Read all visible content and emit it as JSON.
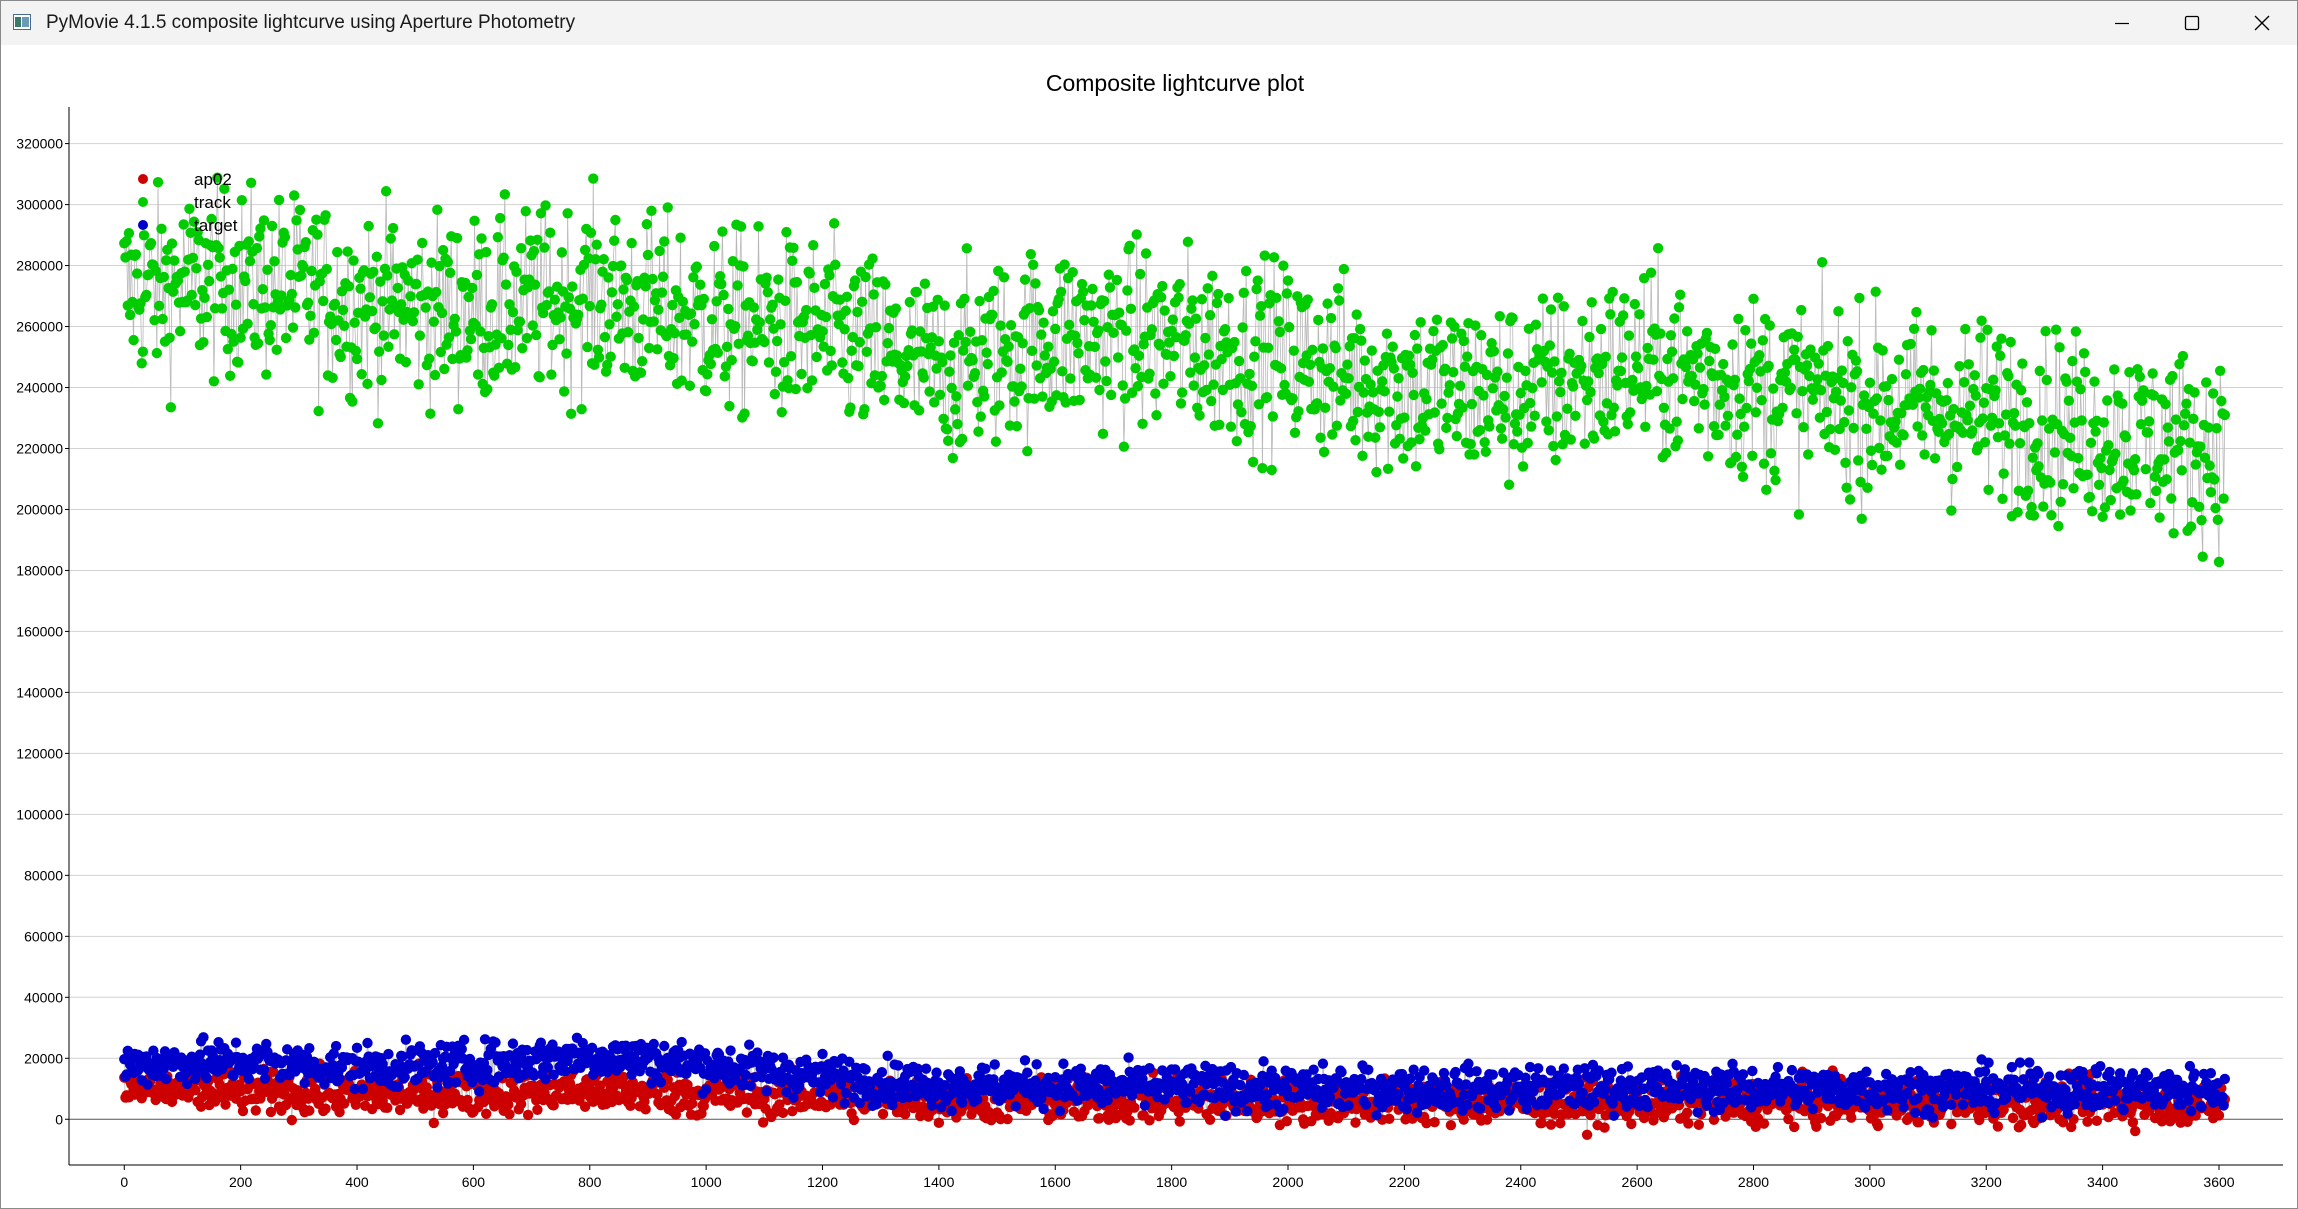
{
  "window": {
    "title": "PyMovie 4.1.5 composite lightcurve using Aperture Photometry",
    "icons": {
      "app": "app-icon",
      "minimize": "minimize-icon",
      "maximize": "maximize-icon",
      "close": "close-icon"
    }
  },
  "chart_data": {
    "type": "scatter",
    "title": "Composite lightcurve plot",
    "xlabel": "",
    "ylabel": "",
    "xlim": [
      -95,
      3710
    ],
    "ylim": [
      -15000,
      332000
    ],
    "xticks": [
      0,
      200,
      400,
      600,
      800,
      1000,
      1200,
      1400,
      1600,
      1800,
      2000,
      2200,
      2400,
      2600,
      2800,
      3000,
      3200,
      3400,
      3600
    ],
    "yticks": [
      0,
      20000,
      40000,
      60000,
      80000,
      100000,
      120000,
      140000,
      160000,
      180000,
      200000,
      220000,
      240000,
      260000,
      280000,
      300000,
      320000
    ],
    "grid": "horizontal",
    "connecting_lines": true,
    "legend": "top-left",
    "frames": [
      0,
      3610
    ],
    "series": [
      {
        "name": "ap02",
        "color": "#cc0000",
        "x": [
          0,
          200,
          400,
          600,
          800,
          1000,
          1200,
          1400,
          1600,
          1800,
          2000,
          2200,
          2400,
          2600,
          2800,
          3000,
          3200,
          3400,
          3600
        ],
        "values": [
          10000,
          9000,
          8000,
          8500,
          9500,
          8000,
          7500,
          6500,
          6000,
          6000,
          5800,
          5500,
          5500,
          5500,
          5500,
          5500,
          5500,
          5500,
          5500
        ],
        "spread": 3500
      },
      {
        "name": "track",
        "color": "#00cc00",
        "x": [
          0,
          200,
          400,
          600,
          800,
          1000,
          1200,
          1400,
          1600,
          1800,
          2000,
          2200,
          2400,
          2600,
          2800,
          3000,
          3200,
          3400,
          3600
        ],
        "values": [
          272000,
          275000,
          268000,
          265000,
          270000,
          262000,
          258000,
          245000,
          257000,
          255000,
          250000,
          240000,
          238000,
          248000,
          240000,
          235000,
          232000,
          225000,
          220000
        ],
        "spread": 15000
      },
      {
        "name": "target",
        "color": "#0000cc",
        "x": [
          0,
          200,
          400,
          600,
          800,
          1000,
          1200,
          1400,
          1600,
          1800,
          2000,
          2200,
          2400,
          2600,
          2800,
          3000,
          3200,
          3400,
          3600
        ],
        "values": [
          18000,
          19000,
          17000,
          18000,
          21000,
          18000,
          14000,
          11000,
          11000,
          10500,
          10000,
          10000,
          10000,
          10500,
          10000,
          10000,
          10000,
          10000,
          10000
        ],
        "spread": 3500
      }
    ]
  }
}
